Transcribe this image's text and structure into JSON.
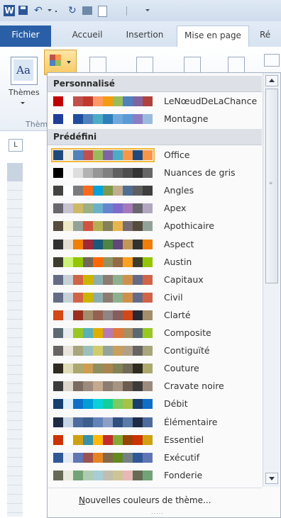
{
  "colors": {
    "file_tab": "#2a5fa7",
    "hover_outline": "#f2b83b",
    "section_header": "#dde1e7"
  },
  "qat": {
    "app_icon": "word-icon",
    "app_letter": "W",
    "icons": [
      "save-icon",
      "undo-icon",
      "redo-icon",
      "print-preview-icon",
      "page-icon",
      "customize-arrow-icon"
    ]
  },
  "tabs": [
    {
      "label": "Fichier",
      "active": false
    },
    {
      "label": "Accueil",
      "active": false
    },
    {
      "label": "Insertion",
      "active": false
    },
    {
      "label": "Mise en page",
      "active": true
    },
    {
      "label": "Ré",
      "active": false
    }
  ],
  "ribbon": {
    "themes_label": "Thèmes",
    "themes_glyph": "Aa",
    "group_label": "Thèm",
    "icons": [
      "margins-icon",
      "orientation-icon",
      "size-icon",
      "columns-icon",
      "breaks-icon"
    ]
  },
  "ruler": {
    "tab_selector": "L"
  },
  "menu": {
    "custom_header": "Personnalisé",
    "builtin_header": "Prédéfini",
    "custom_schemes": [
      {
        "name": "LeNœudDeLaChance",
        "colors": [
          "#c00000",
          "#ffffff",
          "#c0504d",
          "#c0392b",
          "#ff9966",
          "#f39c12",
          "#9bbb59",
          "#4f81bd",
          "#8064a2",
          "#b0413e"
        ]
      },
      {
        "name": "Montagne",
        "colors": [
          "#1f3d99",
          "#ffffff",
          "#1f4e9e",
          "#4f81bd",
          "#4bacc6",
          "#2c7fb8",
          "#6fa8dc",
          "#5b9bd5",
          "#8e7cc3",
          "#9bbbde"
        ]
      }
    ],
    "builtin_schemes": [
      {
        "name": "Office",
        "colors": [
          "#1f497d",
          "#eeece1",
          "#4f81bd",
          "#c0504d",
          "#9bbb59",
          "#8064a2",
          "#4bacc6",
          "#f79646",
          "#1f497d",
          "#f79646"
        ],
        "hover": true
      },
      {
        "name": "Nuances de gris",
        "colors": [
          "#000000",
          "#f8f8f8",
          "#dddddd",
          "#b2b2b2",
          "#969696",
          "#808080",
          "#5f5f5f",
          "#4d4d4d",
          "#333333",
          "#666666"
        ]
      },
      {
        "name": "Angles",
        "colors": [
          "#434342",
          "#ffffff",
          "#797b7e",
          "#f96a1b",
          "#08a1d9",
          "#7c984a",
          "#c2ad8d",
          "#506e94",
          "#5f5f5f",
          "#3e3e3e"
        ]
      },
      {
        "name": "Apex",
        "colors": [
          "#69676d",
          "#c9c2d1",
          "#ceb966",
          "#9cb084",
          "#6bb1c9",
          "#6585cf",
          "#7e6bc9",
          "#a379bb",
          "#69676d",
          "#b2a7c0"
        ]
      },
      {
        "name": "Apothicaire",
        "colors": [
          "#564b3c",
          "#ece9c6",
          "#93a299",
          "#cf543f",
          "#b5ae53",
          "#848058",
          "#e8b54d",
          "#786c71",
          "#564b3c",
          "#93a299"
        ]
      },
      {
        "name": "Aspect",
        "colors": [
          "#323232",
          "#e3ded1",
          "#f07f09",
          "#9f2936",
          "#1b587c",
          "#4e8542",
          "#604878",
          "#c19859",
          "#323232",
          "#f07f09"
        ]
      },
      {
        "name": "Austin",
        "colors": [
          "#3e3d2d",
          "#caf278",
          "#94c600",
          "#71685a",
          "#ff6700",
          "#909465",
          "#956b43",
          "#fea022",
          "#3e3d2d",
          "#94c600"
        ]
      },
      {
        "name": "Capitaux",
        "colors": [
          "#646b86",
          "#c5d1d7",
          "#d16349",
          "#ccb400",
          "#8cadae",
          "#8c7b70",
          "#8fb08c",
          "#d19049",
          "#646b86",
          "#d16349"
        ]
      },
      {
        "name": "Civil",
        "colors": [
          "#646b86",
          "#c5d1d7",
          "#d16349",
          "#ccb400",
          "#8cadae",
          "#8c7b70",
          "#8fb08c",
          "#d19049",
          "#646b86",
          "#d16349"
        ]
      },
      {
        "name": "Clarté",
        "colors": [
          "#d34817",
          "#e4e9ef",
          "#9b2d1f",
          "#a28e6a",
          "#956251",
          "#918485",
          "#855d5d",
          "#d34817",
          "#292934",
          "#a28e6a"
        ]
      },
      {
        "name": "Composite",
        "colors": [
          "#5b6973",
          "#e7ecef",
          "#98c723",
          "#59b0b9",
          "#deae00",
          "#b77bb4",
          "#e0773c",
          "#a98d63",
          "#5b6973",
          "#98c723"
        ]
      },
      {
        "name": "Contiguïté",
        "colors": [
          "#696464",
          "#e9e5dc",
          "#a9a57c",
          "#9cbebd",
          "#d2cb6c",
          "#95a39d",
          "#c89f5d",
          "#b1a089",
          "#696464",
          "#a9a57c"
        ]
      },
      {
        "name": "Couture",
        "colors": [
          "#2f2b20",
          "#dfdcb7",
          "#ada86e",
          "#ce9c52",
          "#8f8f5e",
          "#a8844e",
          "#808356",
          "#726a57",
          "#2f2b20",
          "#ada86e"
        ]
      },
      {
        "name": "Cravate noire",
        "colors": [
          "#3b3b3b",
          "#ddd6cc",
          "#7a6a60",
          "#9c8b7c",
          "#c4a890",
          "#8c7d70",
          "#a69383",
          "#6c5c4f",
          "#3b3b3b",
          "#9c8b7c"
        ]
      },
      {
        "name": "Débit",
        "colors": [
          "#17406d",
          "#dbefff",
          "#0f6fc6",
          "#009dd9",
          "#0bd0d9",
          "#10cf9b",
          "#7cca62",
          "#a5c249",
          "#17406d",
          "#0f6fc6"
        ]
      },
      {
        "name": "Élémentaire",
        "colors": [
          "#1f2a44",
          "#c6d4e4",
          "#4f6c9e",
          "#3d5f8e",
          "#6283b8",
          "#8ca0c6",
          "#2f4f7f",
          "#5a7aa8",
          "#1f2a44",
          "#4f6c9e"
        ]
      },
      {
        "name": "Essentiel",
        "colors": [
          "#cc3300",
          "#ffffff",
          "#d0a013",
          "#3891a7",
          "#feb80a",
          "#c32d2e",
          "#84aa33",
          "#964305",
          "#cc3300",
          "#d0a013"
        ]
      },
      {
        "name": "Exécutif",
        "colors": [
          "#2f5897",
          "#e4e9f6",
          "#6076b4",
          "#9c5252",
          "#e68422",
          "#846648",
          "#63891f",
          "#758085",
          "#2f5897",
          "#6076b4"
        ]
      },
      {
        "name": "Fonderie",
        "colors": [
          "#676a55",
          "#eaebde",
          "#72a376",
          "#b0ccb0",
          "#a8cdd7",
          "#c0beaf",
          "#cec597",
          "#e8b7b7",
          "#676a55",
          "#72a376"
        ]
      }
    ],
    "new_colors_prefix": "N",
    "new_colors_rest": "ouvelles couleurs de thème...",
    "scrollbar": {
      "up_icon": "scroll-up-icon",
      "down_icon": "scroll-down-icon",
      "thumb": "scroll-thumb"
    },
    "grip": "....."
  }
}
